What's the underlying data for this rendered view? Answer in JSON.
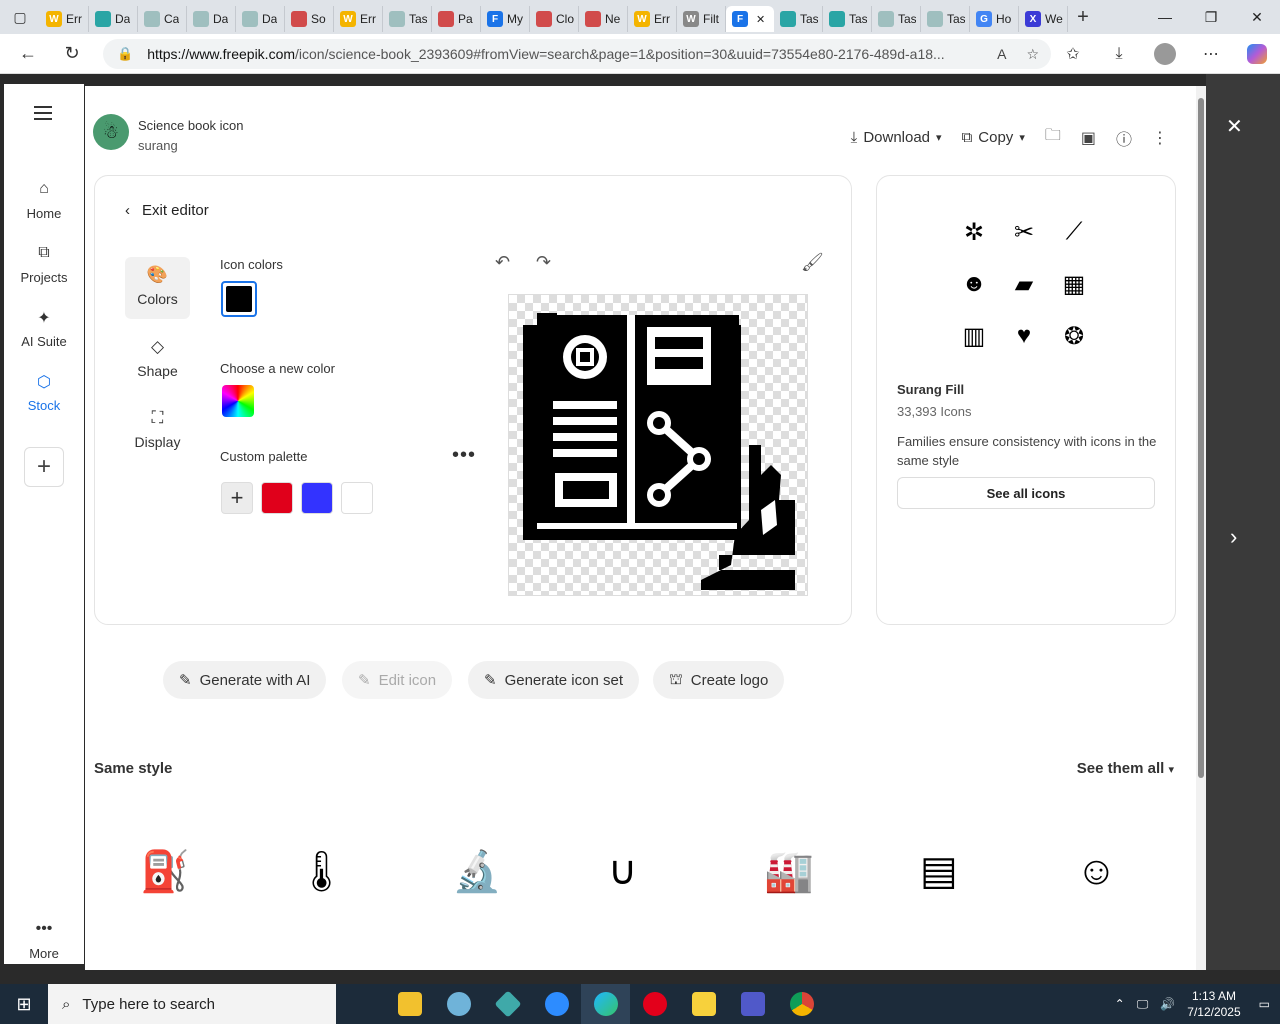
{
  "browser": {
    "tabs": [
      {
        "label": "Err",
        "color": "#f4b400",
        "glyph": "W"
      },
      {
        "label": "Da",
        "color": "#2aa5a5",
        "glyph": ""
      },
      {
        "label": "Ca",
        "color": "#9fbfbf",
        "glyph": ""
      },
      {
        "label": "Da",
        "color": "#9fbfbf",
        "glyph": ""
      },
      {
        "label": "Da",
        "color": "#9fbfbf",
        "glyph": ""
      },
      {
        "label": "So",
        "color": "#d14b4b",
        "glyph": ""
      },
      {
        "label": "Err",
        "color": "#f4b400",
        "glyph": "W"
      },
      {
        "label": "Tas",
        "color": "#9fbfbf",
        "glyph": ""
      },
      {
        "label": "Pa",
        "color": "#d14b4b",
        "glyph": ""
      },
      {
        "label": "My",
        "color": "#1a73e8",
        "glyph": "F"
      },
      {
        "label": "Clo",
        "color": "#d14b4b",
        "glyph": ""
      },
      {
        "label": "Ne",
        "color": "#d14b4b",
        "glyph": ""
      },
      {
        "label": "Err",
        "color": "#f4b400",
        "glyph": "W"
      },
      {
        "label": "Filt",
        "color": "#888888",
        "glyph": "W"
      },
      {
        "label": "",
        "color": "#1a73e8",
        "glyph": "F",
        "active": true
      },
      {
        "label": "Tas",
        "color": "#2aa5a5",
        "glyph": ""
      },
      {
        "label": "Tas",
        "color": "#2aa5a5",
        "glyph": ""
      },
      {
        "label": "Tas",
        "color": "#9fbfbf",
        "glyph": ""
      },
      {
        "label": "Tas",
        "color": "#9fbfbf",
        "glyph": ""
      },
      {
        "label": "Ho",
        "color": "#4285f4",
        "glyph": "G"
      },
      {
        "label": "We",
        "color": "#3b3bd6",
        "glyph": "X"
      }
    ],
    "url_host": "https://www.freepik.com",
    "url_rest": "/icon/science-book_2393609#fromView=search&page=1&position=30&uuid=73554e80-2176-489d-a18..."
  },
  "rail": {
    "items": [
      {
        "label": "Home",
        "icon": "home-icon"
      },
      {
        "label": "Projects",
        "icon": "folder-icon"
      },
      {
        "label": "AI Suite",
        "icon": "sparkle-icon"
      },
      {
        "label": "Stock",
        "icon": "stock-icon"
      }
    ],
    "more_label": "More"
  },
  "header": {
    "title": "Science book icon",
    "author": "surang",
    "download_label": "Download",
    "copy_label": "Copy"
  },
  "editor": {
    "exit_label": "Exit editor",
    "tools": [
      {
        "label": "Colors"
      },
      {
        "label": "Shape"
      },
      {
        "label": "Display"
      }
    ],
    "icon_colors_label": "Icon colors",
    "choose_color_label": "Choose a new color",
    "custom_palette_label": "Custom palette",
    "palette": [
      "#e0001b",
      "#3333ff",
      "#ffffff"
    ],
    "selected_color": "#000000"
  },
  "family": {
    "name": "Surang Fill",
    "count": "33,393 Icons",
    "description": "Families ensure consistency with icons in the same style",
    "see_all_label": "See all icons"
  },
  "actions": {
    "generate_ai": "Generate with AI",
    "edit_icon": "Edit icon",
    "generate_set": "Generate icon set",
    "create_logo": "Create logo"
  },
  "same_style": {
    "title": "Same style",
    "see_all": "See them all"
  },
  "taskbar": {
    "search_placeholder": "Type here to search",
    "time": "1:13 AM",
    "date": "7/12/2025"
  }
}
